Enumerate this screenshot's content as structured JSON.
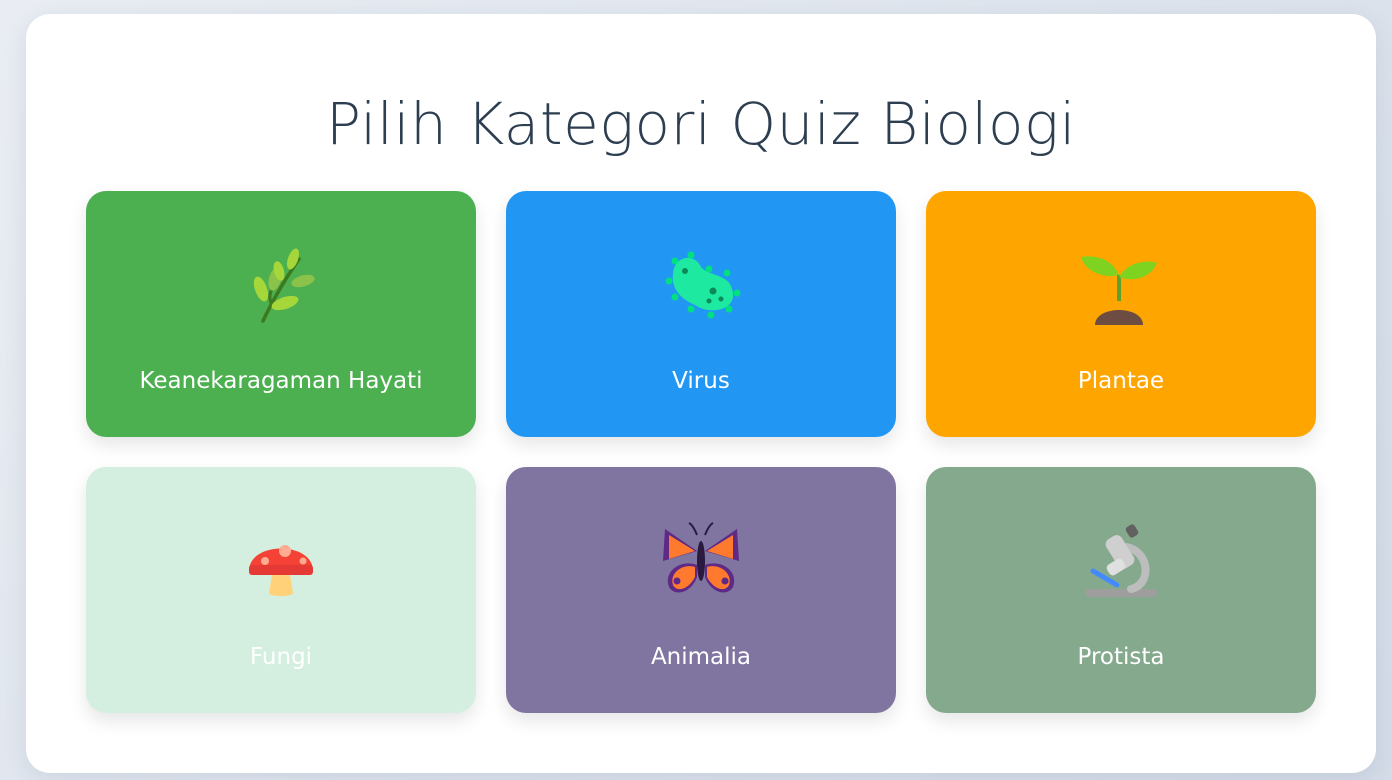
{
  "page": {
    "title": "Pilih Kategori Quiz Biologi"
  },
  "categories": [
    {
      "label": "Keanekaragaman Hayati",
      "color": "#4caf50",
      "icon": "herb-icon"
    },
    {
      "label": "Virus",
      "color": "#2196f3",
      "icon": "microbe-icon"
    },
    {
      "label": "Plantae",
      "color": "#ffa500",
      "icon": "seedling-icon"
    },
    {
      "label": "Fungi",
      "color": "#d4efdf",
      "icon": "mushroom-icon"
    },
    {
      "label": "Animalia",
      "color": "#8074a1",
      "icon": "butterfly-icon"
    },
    {
      "label": "Protista",
      "color": "#85a98c",
      "icon": "microscope-icon"
    }
  ]
}
